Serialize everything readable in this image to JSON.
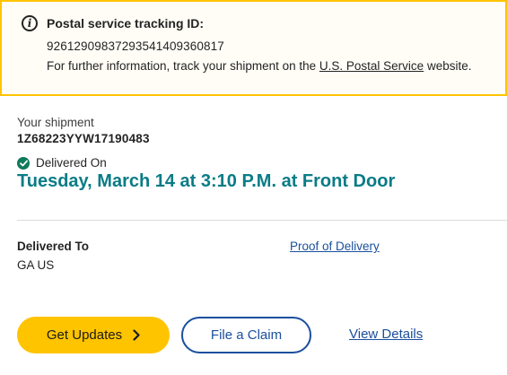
{
  "notice": {
    "icon": "info-icon",
    "title": "Postal service tracking ID:",
    "tracking_id": "9261290983729354140936081​7",
    "info_prefix": "For further information, track your shipment on the ",
    "info_link": "U.S. Postal Service",
    "info_suffix": " website.",
    "border_color": "#ffc400"
  },
  "shipment": {
    "label": "Your shipment",
    "number": "1Z68223YYW17190483",
    "status_icon": "check-circle-icon",
    "status_label": "Delivered On",
    "delivered_datetime": "Tuesday, March 14 at 3:10 P.M. at Front Door",
    "accent_color": "#0a7c86"
  },
  "destination": {
    "label": "Delivered To",
    "value": "GA US",
    "proof_link": "Proof of Delivery"
  },
  "actions": {
    "get_updates": "Get Updates",
    "get_updates_icon": "chevron-right-icon",
    "file_claim": "File a Claim",
    "view_details": "View Details",
    "primary_color": "#ffc400",
    "link_color": "#1a4f9c"
  }
}
